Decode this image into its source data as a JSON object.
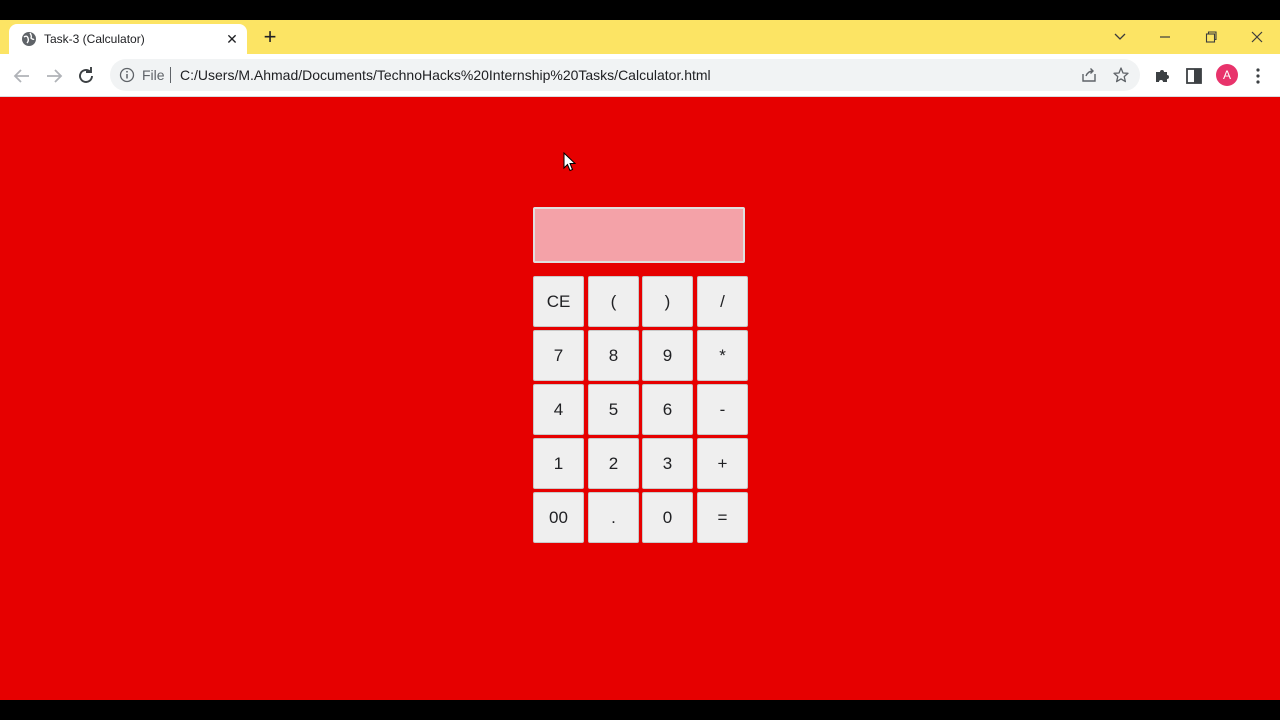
{
  "tab": {
    "title": "Task-3 (Calculator)",
    "close_glyph": "✕",
    "favicon": "globe-icon"
  },
  "new_tab_glyph": "+",
  "window_controls": {
    "tab_search": "chevron-down-icon",
    "minimize": "minimize-icon",
    "restore": "restore-icon",
    "close": "close-icon"
  },
  "omnibox": {
    "scheme": "File",
    "url": "C:/Users/M.Ahmad/Documents/TechnoHacks%20Internship%20Tasks/Calculator.html"
  },
  "profile": {
    "initial": "A",
    "color": "#e8336b"
  },
  "calculator": {
    "display_value": "",
    "keys": [
      [
        "CE",
        "(",
        ")",
        "/"
      ],
      [
        "7",
        "8",
        "9",
        "*"
      ],
      [
        "4",
        "5",
        "6",
        "-"
      ],
      [
        "1",
        "2",
        "3",
        "+"
      ],
      [
        "00",
        ".",
        "0",
        "="
      ]
    ]
  },
  "colors": {
    "page_background": "#e60000",
    "tab_strip": "#fce464",
    "display_background": "#f4a2a8",
    "key_background": "#efefef"
  }
}
